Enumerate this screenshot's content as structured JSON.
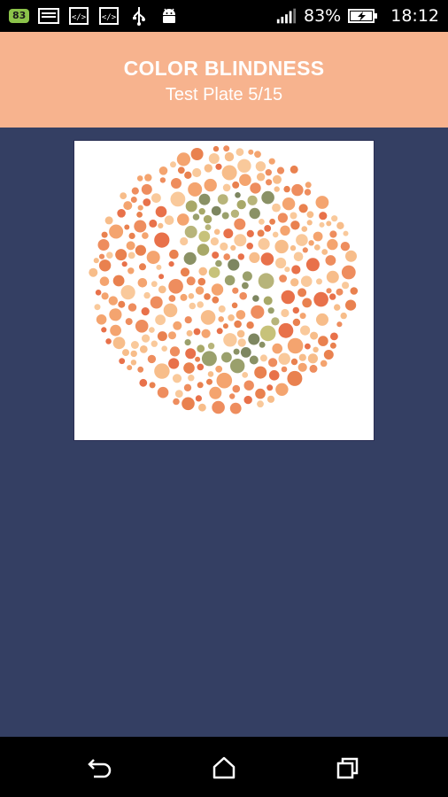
{
  "status_bar": {
    "notification_badge": "83",
    "notification_icons": [
      "image-icon",
      "code-icon",
      "code-icon",
      "usb-icon",
      "android-icon"
    ],
    "signal_icon": "signal-icon",
    "battery_percent": "83%",
    "battery_icon": "battery-charging-icon",
    "time": "18:12"
  },
  "header": {
    "title": "COLOR BLINDNESS",
    "subtitle": "Test Plate 5/15",
    "background_color": "#f7b38e"
  },
  "plate": {
    "icon": "ishihara-plate",
    "background_colors": [
      "#f4a46f",
      "#e8714a",
      "#f7bd8a",
      "#ee8d5e",
      "#f9c99b",
      "#e9814f"
    ],
    "figure_colors": [
      "#8a9165",
      "#a8a868",
      "#c7c27a",
      "#7d8660",
      "#b7b47a",
      "#9aa06c"
    ]
  },
  "content": {
    "background_color": "#343f63"
  },
  "nav_bar": {
    "back": "back-icon",
    "home": "home-icon",
    "recents": "recents-icon"
  }
}
